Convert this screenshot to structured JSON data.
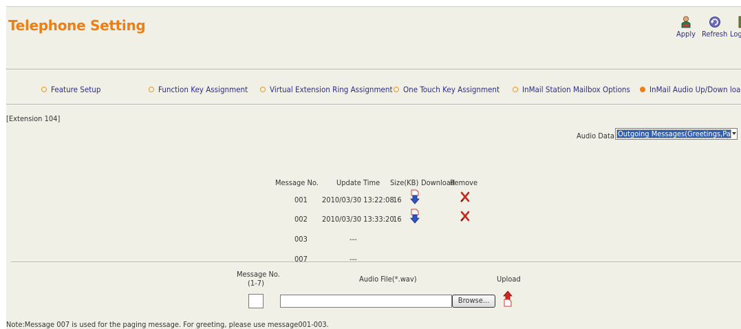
{
  "header": {
    "title": "Telephone Setting",
    "toolbar": [
      {
        "label": "Apply",
        "icon": "apply-person-icon"
      },
      {
        "label": "Refresh",
        "icon": "refresh-icon"
      },
      {
        "label": "Logout",
        "icon": "logout-door-icon"
      }
    ]
  },
  "tabs": [
    {
      "label": "Feature Setup",
      "active": false
    },
    {
      "label": "Function Key Assignment",
      "active": false
    },
    {
      "label": "Virtual Extension Ring Assignment",
      "active": false
    },
    {
      "label": "One Touch Key Assignment",
      "active": false
    },
    {
      "label": "InMail Station Mailbox Options",
      "active": false
    },
    {
      "label": "InMail Audio Up/Down load",
      "active": true
    }
  ],
  "extension_label": "[Extension 104]",
  "audio_data": {
    "label": "Audio Data",
    "selected": "Outgoing Messages(Greetings,Paging)"
  },
  "table": {
    "headers": [
      "Message No.",
      "Update Time",
      "Size(KB)",
      "Download",
      "Remove"
    ],
    "rows": [
      {
        "no": "001",
        "time": "2010/03/30 13:22:08",
        "size": "16",
        "download": true,
        "remove": true
      },
      {
        "no": "002",
        "time": "2010/03/30 13:33:20",
        "size": "16",
        "download": true,
        "remove": true
      },
      {
        "no": "003",
        "time": "---",
        "size": "",
        "download": false,
        "remove": false
      },
      {
        "no": "007",
        "time": "---",
        "size": "",
        "download": false,
        "remove": false
      }
    ]
  },
  "upload": {
    "msgno_label_line1": "Message No.",
    "msgno_label_line2": "(1-7)",
    "msgno_value": "",
    "file_label": "Audio File(*.wav)",
    "file_value": "",
    "browse_label": "Browse...",
    "upload_label": "Upload"
  },
  "note": "Note:Message 007 is used for the paging message. For greeting, please use message001-003.",
  "colors": {
    "background": "#f1f0e6",
    "title": "#f07e12",
    "link": "#2d2d8a",
    "selection": "#2f5fb5"
  }
}
